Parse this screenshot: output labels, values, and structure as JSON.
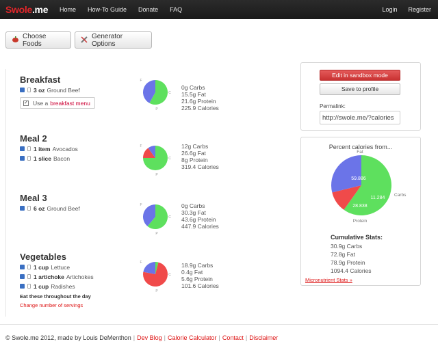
{
  "nav": {
    "brand_red": "Swole",
    "brand_white": ".me",
    "links": [
      "Home",
      "How-To Guide",
      "Donate",
      "FAQ"
    ],
    "right_links": [
      "Login",
      "Register"
    ]
  },
  "toolbar": {
    "choose_foods": "Choose Foods",
    "generator_options": "Generator Options"
  },
  "meals": [
    {
      "title": "Breakfast",
      "foods": [
        {
          "qty": "3 oz",
          "name": "Ground Beef"
        }
      ],
      "checkbox": {
        "prefix": "Use a",
        "link": "breakfast menu",
        "checked": true
      },
      "stats": [
        "0g Carbs",
        "15.5g Fat",
        "21.6g Protein",
        "225.9 Calories"
      ],
      "pie": {
        "fat": 58,
        "carbs": 0,
        "protein": 42
      }
    },
    {
      "title": "Meal 2",
      "foods": [
        {
          "qty": "1 item",
          "name": "Avocados"
        },
        {
          "qty": "1 slice",
          "name": "Bacon"
        }
      ],
      "stats": [
        "12g Carbs",
        "26.6g Fat",
        "8g Protein",
        "319.4 Calories"
      ],
      "pie": {
        "fat": 75,
        "carbs": 15,
        "protein": 10
      }
    },
    {
      "title": "Meal 3",
      "foods": [
        {
          "qty": "6 oz",
          "name": "Ground Beef"
        }
      ],
      "stats": [
        "0g Carbs",
        "30.3g Fat",
        "43.6g Protein",
        "447.9 Calories"
      ],
      "pie": {
        "fat": 61,
        "carbs": 0,
        "protein": 39
      }
    },
    {
      "title": "Vegetables",
      "foods": [
        {
          "qty": "1 cup",
          "name": "Lettuce"
        },
        {
          "qty": "1 artichoke",
          "name": "Artichokes"
        },
        {
          "qty": "1 cup",
          "name": "Radishes"
        }
      ],
      "tip": "Eat these throughout the day",
      "change_link": "Change number of servings",
      "stats": [
        "18.9g Carbs",
        "0.4g Fat",
        "5.6g Protein",
        "101.6 Calories"
      ],
      "pie": {
        "fat": 4,
        "carbs": 74,
        "protein": 22
      }
    }
  ],
  "pie_labels": {
    "fat": "F",
    "carbs": "C",
    "protein": "P"
  },
  "sidebar": {
    "sandbox_btn": "Edit in sandbox mode",
    "save_btn": "Save to profile",
    "permalink_label": "Permalink:",
    "permalink_value": "http://swole.me/?calories",
    "percent_title": "Percent calories from...",
    "big_pie": {
      "fat": 59.886,
      "carbs": 11.284,
      "protein": 28.838
    },
    "big_pie_labels": {
      "fat": "Fat",
      "carbs": "Carbs",
      "protein": "Protein"
    },
    "big_pie_values": {
      "fat": "59.886",
      "carbs": "11.284",
      "protein": "28.838"
    },
    "cumulative_title": "Cumulative Stats:",
    "cumulative": [
      "30.9g Carbs",
      "72.8g Fat",
      "78.9g Protein",
      "1094.4 Calories"
    ],
    "micro_link": "Micronutrient Stats »"
  },
  "footer": {
    "copyright": "© Swole.me 2012, made by Louis DeMenthon",
    "links": [
      "Dev Blog",
      "Calorie Calculator",
      "Contact",
      "Disclaimer"
    ]
  },
  "colors": {
    "fat": "#5ee05e",
    "carbs": "#f04a4a",
    "protein": "#6b74e8"
  }
}
